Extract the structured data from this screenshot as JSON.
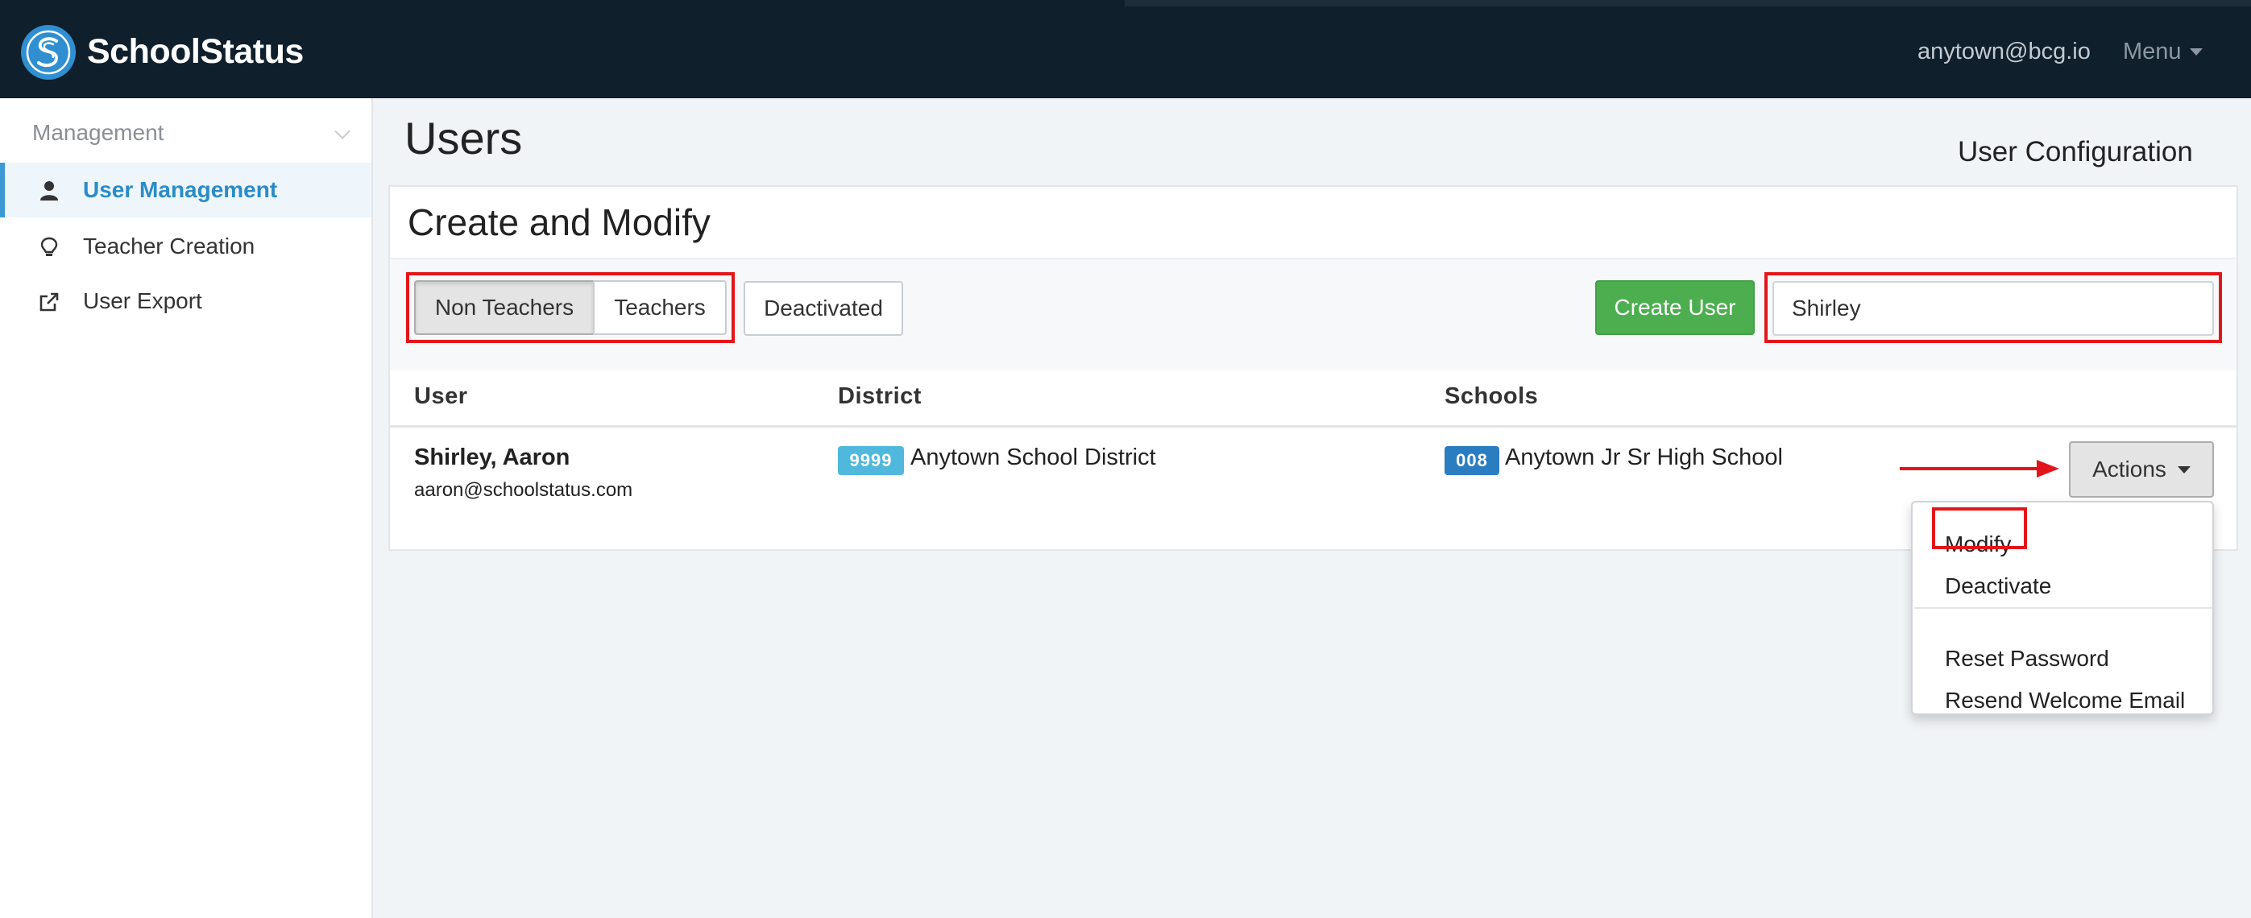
{
  "app": {
    "brand": "SchoolStatus",
    "user_email": "anytown@bcg.io",
    "menu_label": "Menu"
  },
  "sidebar": {
    "header": "Management",
    "items": [
      {
        "label": "User Management",
        "icon": "user-icon",
        "active": true
      },
      {
        "label": "Teacher Creation",
        "icon": "lightbulb-icon",
        "active": false
      },
      {
        "label": "User Export",
        "icon": "external-link-icon",
        "active": false
      }
    ]
  },
  "main": {
    "title": "Users",
    "subtitle": "User Configuration",
    "panel_title": "Create and Modify",
    "filters": {
      "non_teachers": "Non Teachers",
      "teachers": "Teachers",
      "deactivated": "Deactivated"
    },
    "create_user_label": "Create User",
    "search_value": "Shirley",
    "table": {
      "columns": [
        "User",
        "District",
        "Schools"
      ],
      "rows": [
        {
          "name": "Shirley, Aaron",
          "email": "aaron@schoolstatus.com",
          "district_code": "9999",
          "district_name": "Anytown School District",
          "school_code": "008",
          "school_name": "Anytown Jr Sr High School",
          "actions_label": "Actions"
        }
      ]
    },
    "actions_menu": [
      "Modify",
      "Deactivate",
      "Reset Password",
      "Resend Welcome Email"
    ]
  },
  "colors": {
    "navbar": "#0f1f2c",
    "accent": "#3b9ad3",
    "create_button": "#4cae4f",
    "district_badge": "#4fb8dc",
    "school_badge": "#2a7dc1",
    "highlight": "#e3151a"
  }
}
